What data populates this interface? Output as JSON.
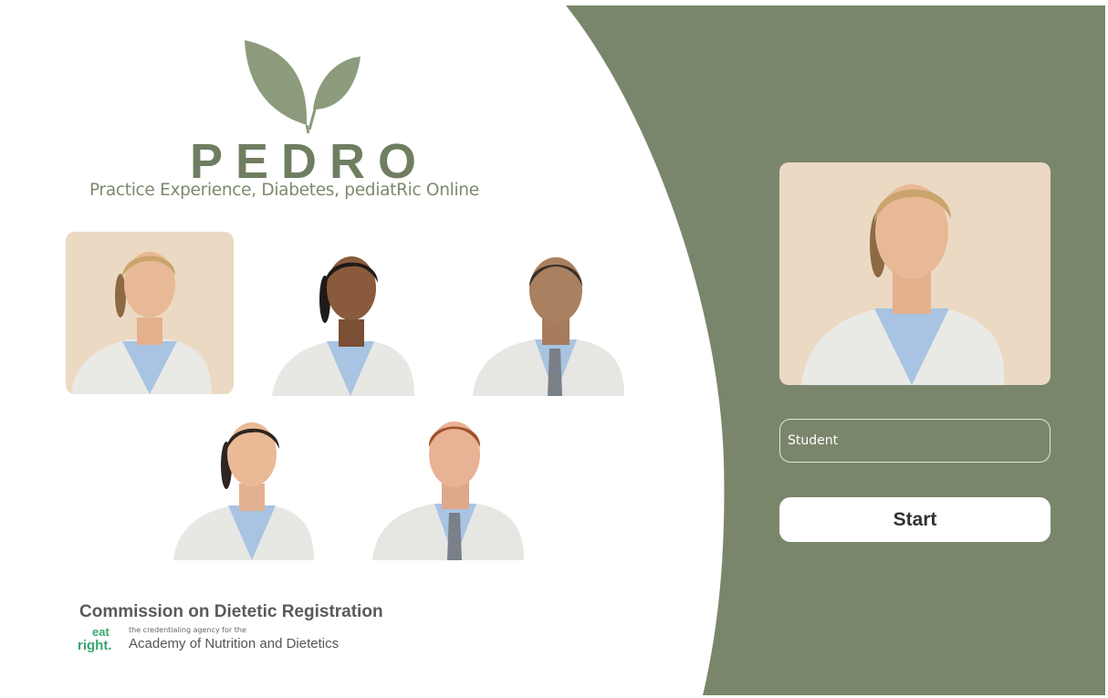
{
  "app": {
    "title": "PEDRO",
    "subtitle": "Practice Experience, Diabetes, pediatRic Online"
  },
  "avatars": [
    {
      "id": "blonde-woman",
      "selected": true
    },
    {
      "id": "dark-hair-woman",
      "selected": false
    },
    {
      "id": "bald-man",
      "selected": false
    },
    {
      "id": "brunette-woman",
      "selected": false
    },
    {
      "id": "red-hair-man",
      "selected": false
    }
  ],
  "preview": {
    "avatar": "blonde-woman"
  },
  "name_input": {
    "value": "Student",
    "placeholder": ""
  },
  "start_button": {
    "label": "Start"
  },
  "footer": {
    "org": "Commission on Dietetic Registration",
    "tagline": "the credentialing agency for the",
    "academy": "Academy of Nutrition and Dietetics",
    "logo_top": "eat",
    "logo_bottom": "right."
  },
  "colors": {
    "accent_green": "#7a866b",
    "logo_green": "#6f7e60",
    "avatar_bg": "#ecd9c3",
    "eatright_green": "#3aa56f"
  }
}
